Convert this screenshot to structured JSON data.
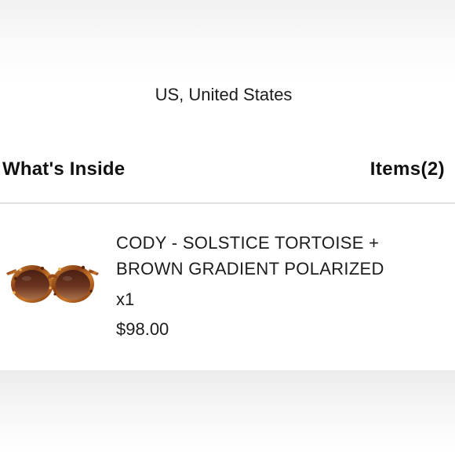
{
  "shipping": {
    "region": "US, United States"
  },
  "order_summary": {
    "section_title": "What's Inside",
    "items_count_label": "Items(2)"
  },
  "items": [
    {
      "name": "CODY - SOLSTICE TORTOISE + BROWN GRADIENT POLARIZED",
      "quantity": "x1",
      "price": "$98.00",
      "image": "tortoise-sunglasses-icon"
    }
  ],
  "colors": {
    "frame_tortoise": "#b8661e",
    "lens_brown": "#6b3420",
    "divider": "#e3e3e3"
  }
}
